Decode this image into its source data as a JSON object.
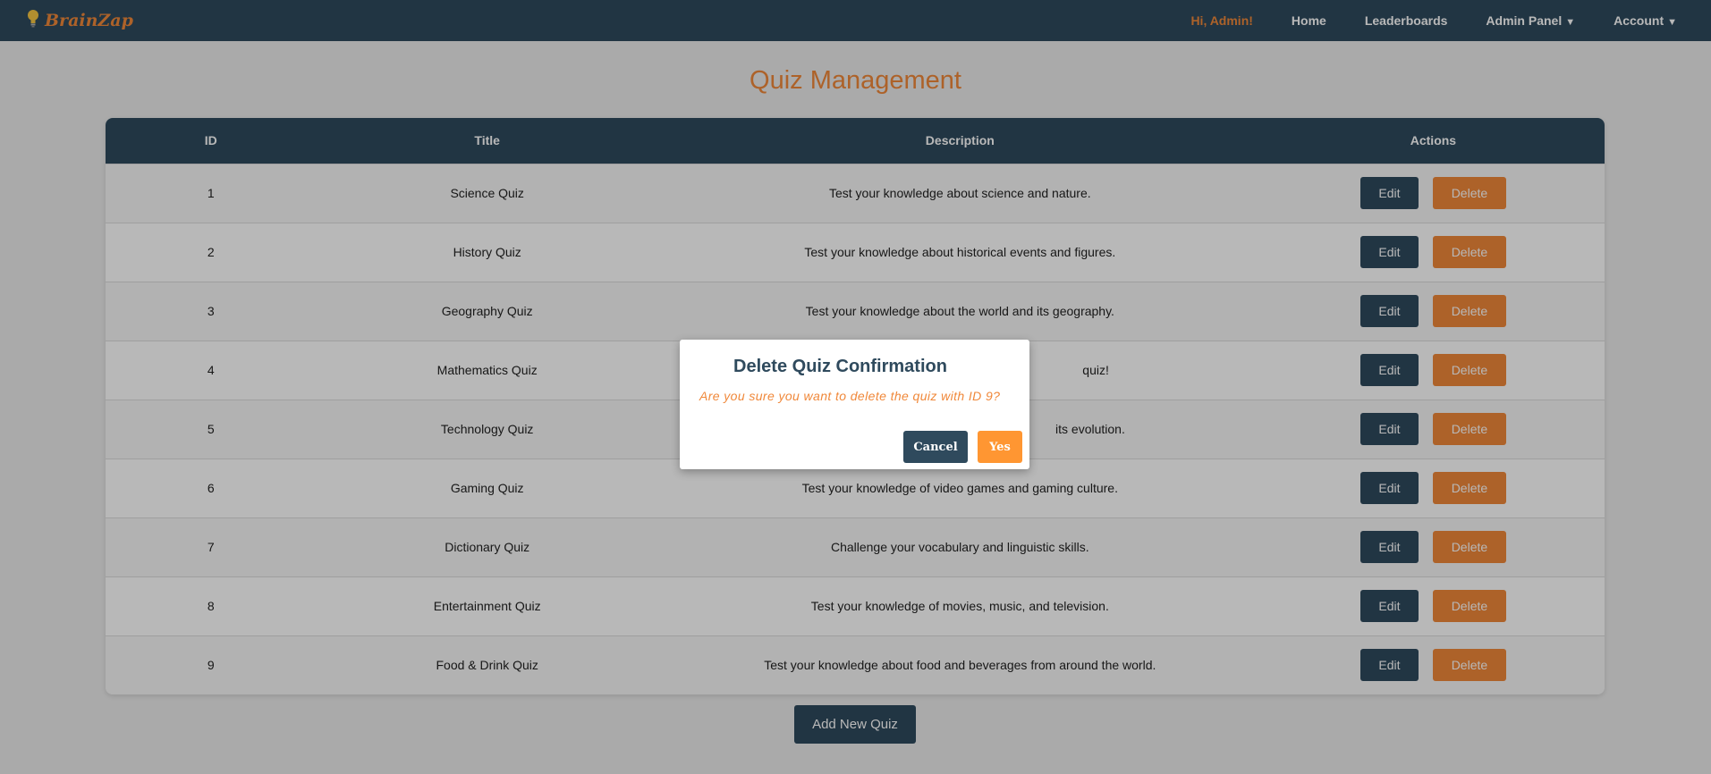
{
  "brand": {
    "name": "BrainZap",
    "logo_icon": "lightbulb-icon"
  },
  "nav": {
    "greeting": "Hi, Admin!",
    "home": "Home",
    "leaderboards": "Leaderboards",
    "admin_panel": "Admin Panel",
    "account": "Account",
    "dropdown_caret": "▼"
  },
  "page": {
    "title": "Quiz Management",
    "add_button": "Add New Quiz"
  },
  "table": {
    "headers": {
      "id": "ID",
      "title": "Title",
      "description": "Description",
      "actions": "Actions"
    },
    "edit_label": "Edit",
    "delete_label": "Delete",
    "rows": [
      {
        "id": "1",
        "title": "Science Quiz",
        "description": "Test your knowledge about science and nature."
      },
      {
        "id": "2",
        "title": "History Quiz",
        "description": "Test your knowledge about historical events and figures."
      },
      {
        "id": "3",
        "title": "Geography Quiz",
        "description": "Test your knowledge about the world and its geography."
      },
      {
        "id": "4",
        "title": "Mathematics Quiz",
        "description": "quiz!"
      },
      {
        "id": "5",
        "title": "Technology Quiz",
        "description": "its evolution."
      },
      {
        "id": "6",
        "title": "Gaming Quiz",
        "description": "Test your knowledge of video games and gaming culture."
      },
      {
        "id": "7",
        "title": "Dictionary Quiz",
        "description": "Challenge your vocabulary and linguistic skills."
      },
      {
        "id": "8",
        "title": "Entertainment Quiz",
        "description": "Test your knowledge of movies, music, and television."
      },
      {
        "id": "9",
        "title": "Food & Drink Quiz",
        "description": "Test your knowledge about food and beverages from around the world."
      }
    ]
  },
  "modal": {
    "title": "Delete Quiz Confirmation",
    "message": "Are you sure you want to delete the quiz with ID 9?",
    "cancel_label": "Cancel",
    "yes_label": "Yes"
  },
  "colors": {
    "navbar": "#2f4a5d",
    "accent": "#f0883a",
    "yes_button": "#ff9632",
    "background": "#ececec"
  }
}
